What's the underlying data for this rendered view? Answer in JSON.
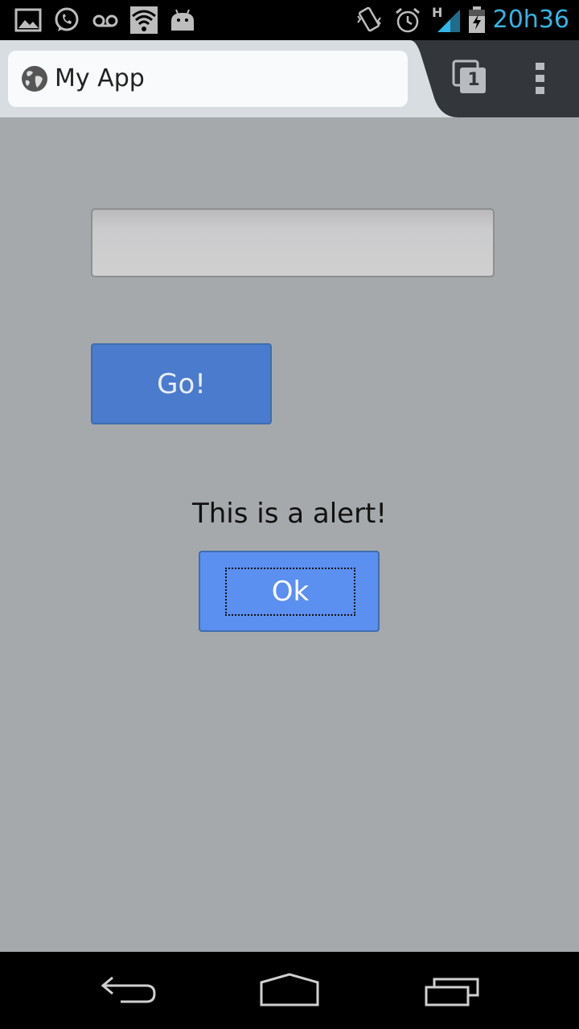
{
  "status_bar": {
    "time": "20h36",
    "network_label": "H",
    "left_icons": [
      "gallery-icon",
      "whatsapp-icon",
      "voicemail-icon",
      "wifi-icon",
      "android-icon"
    ],
    "right_icons": [
      "vibrate-icon",
      "alarm-icon",
      "signal-icon",
      "battery-charging-icon"
    ],
    "clock_color": "#33b5e5"
  },
  "browser": {
    "page_title": "My App",
    "tab_count": "1",
    "toolbar_color": "#d8dde2",
    "toolbar_dark_color": "#33373b"
  },
  "form": {
    "input_value": "",
    "go_label": "Go!"
  },
  "alert": {
    "message": "This is a alert!",
    "ok_label": "Ok"
  },
  "nav_bar": {
    "buttons": [
      "back-icon",
      "home-icon",
      "recent-apps-icon"
    ]
  },
  "colors": {
    "background": "#a6a9ab",
    "go_button": "#4b7bcc",
    "ok_button": "#5b8ff0"
  }
}
